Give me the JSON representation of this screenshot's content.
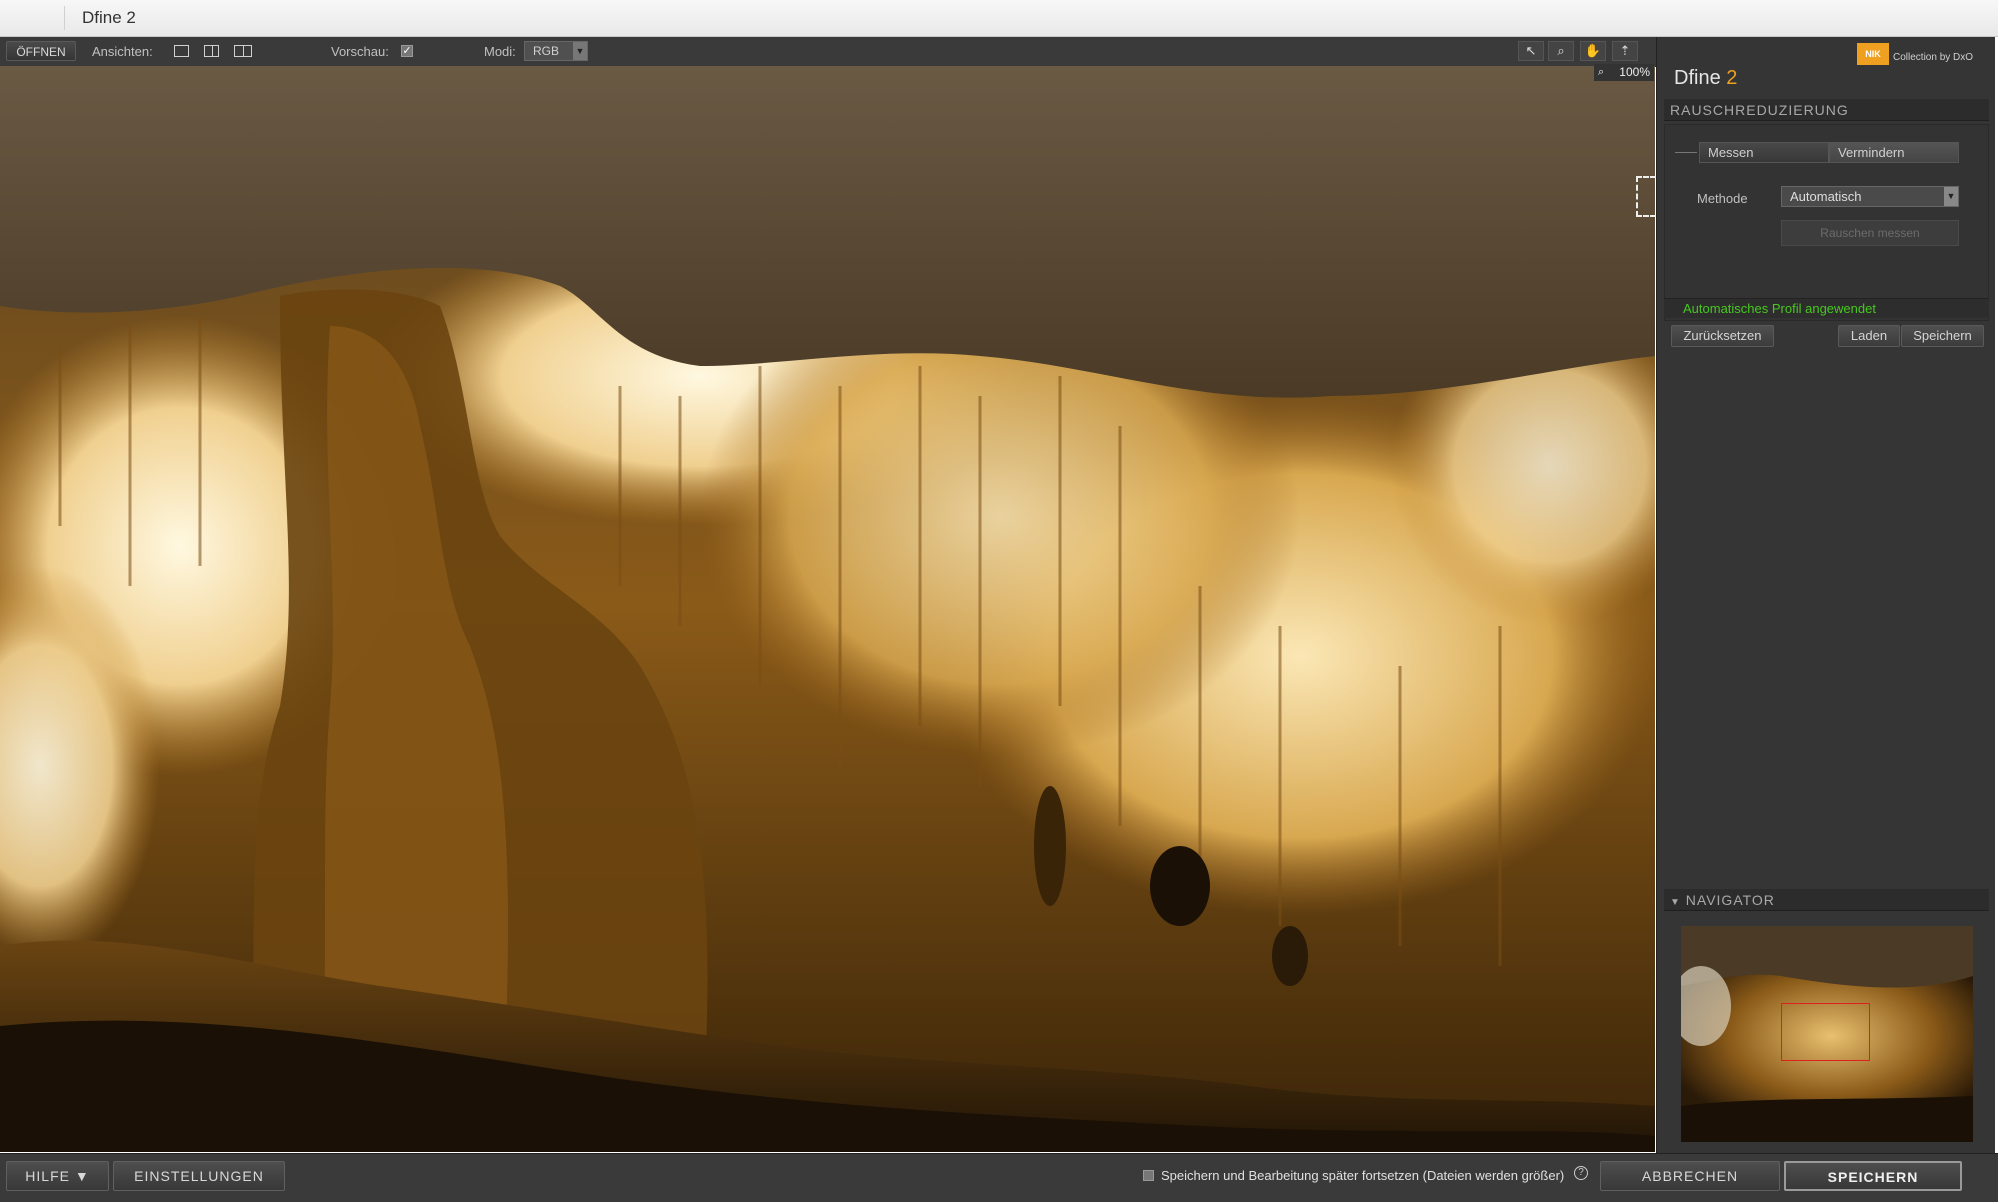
{
  "window": {
    "title": "Dfine 2"
  },
  "toolbar": {
    "open_label": "ÖFFNEN",
    "views_label": "Ansichten:",
    "preview_label": "Vorschau:",
    "preview_checked": "✓",
    "mode_label": "Modi:",
    "mode_value": "RGB",
    "tool_icons": [
      "arrow-pointer-icon",
      "zoom-icon",
      "hand-icon",
      "compare-icon"
    ]
  },
  "canvas": {
    "zoom_label": "100%"
  },
  "panel": {
    "brand_text": "Collection by DxO",
    "logo_text": "NIK",
    "app_name": "Dfine",
    "app_version": "2",
    "section_title": "RAUSCHREDUZIERUNG",
    "tabs": {
      "measure": "Messen",
      "reduce": "Vermindern"
    },
    "method_label": "Methode",
    "method_value": "Automatisch",
    "measure_button": "Rauschen messen",
    "status": "Automatisches Profil angewendet",
    "reset_button": "Zurücksetzen",
    "load_button": "Laden",
    "save_button": "Speichern",
    "navigator_title": "NAVIGATOR"
  },
  "bottom": {
    "help_label": "HILFE ▼",
    "settings_label": "EINSTELLUNGEN",
    "save_later_text": "Speichern und Bearbeitung später fortsetzen (Dateien werden größer)",
    "cancel_label": "ABBRECHEN",
    "save_label": "SPEICHERN"
  },
  "colors": {
    "accent": "#f0a020",
    "status_green": "#46c81e",
    "navigator_frame": "#e02020"
  }
}
